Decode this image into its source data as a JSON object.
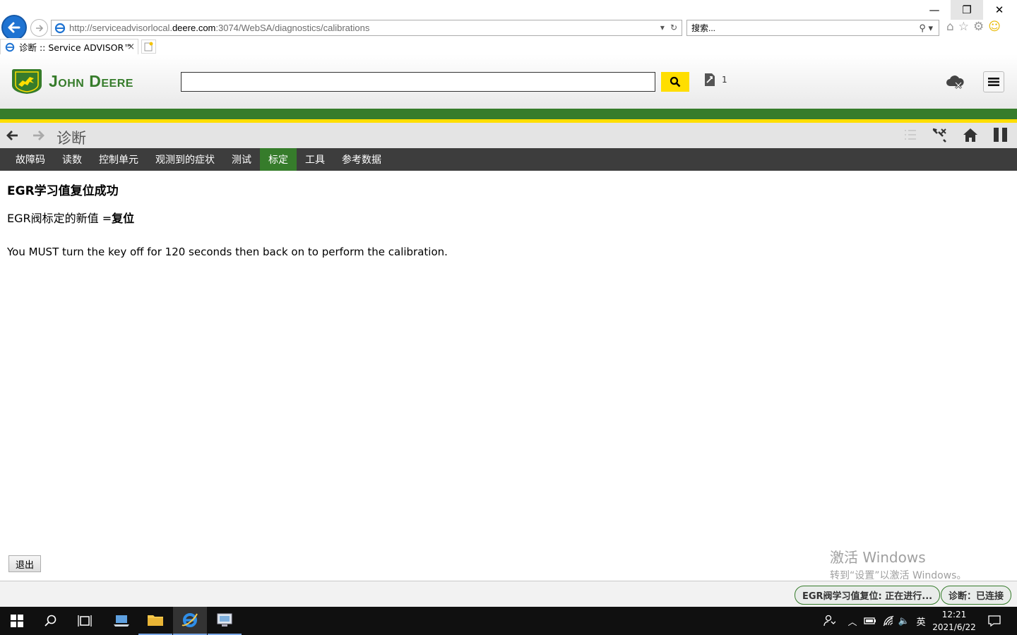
{
  "browser": {
    "url_prefix": "http://serviceadvisorlocal.",
    "url_domain": "deere.com",
    "url_suffix": ":3074/WebSA/diagnostics/calibrations",
    "search_placeholder": "搜索...",
    "tab_title": "诊断 :: Service ADVISOR™",
    "tab_close": "×"
  },
  "header": {
    "brand": "John Deere",
    "tool_count": "1"
  },
  "section": {
    "title": "诊断"
  },
  "menu": {
    "items": [
      {
        "label": "故障码",
        "active": false
      },
      {
        "label": "读数",
        "active": false
      },
      {
        "label": "控制单元",
        "active": false
      },
      {
        "label": "观测到的症状",
        "active": false
      },
      {
        "label": "测试",
        "active": false
      },
      {
        "label": "标定",
        "active": true
      },
      {
        "label": "工具",
        "active": false
      },
      {
        "label": "参考数据",
        "active": false
      }
    ]
  },
  "content": {
    "title": "EGR学习值复位成功",
    "new_value_label": "EGR阀标定的新值 =",
    "new_value": "复位",
    "note": "You MUST turn the key off for 120 seconds then back on to perform the calibration."
  },
  "footer": {
    "exit_label": "退出"
  },
  "watermark": {
    "line1": "激活 Windows",
    "line2": "转到“设置”以激活 Windows。"
  },
  "status": {
    "task": "EGR阀学习值复位: 正在进行...",
    "connection": "诊断：已连接"
  },
  "taskbar": {
    "ime": "英",
    "time": "12:21",
    "date": "2021/6/22"
  },
  "colors": {
    "jd_green": "#367c2b",
    "jd_yellow": "#ffde00",
    "nav_dark": "#3d3d3d"
  }
}
